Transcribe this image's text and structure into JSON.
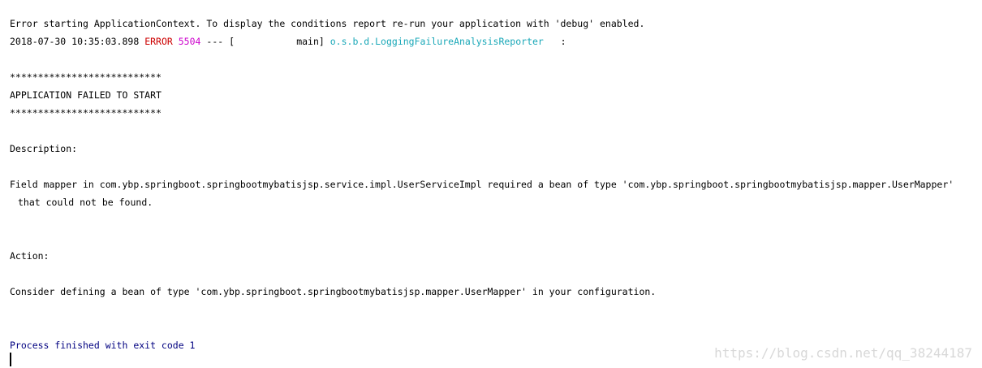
{
  "console": {
    "line1": "Error starting ApplicationContext. To display the conditions report re-run your application with 'debug' enabled.",
    "log": {
      "timestamp": "2018-07-30 10:35:03.898",
      "level": "ERROR",
      "pid": "5504",
      "separator": "---",
      "thread": "[           main]",
      "logger": "o.s.b.d.LoggingFailureAnalysisReporter",
      "colon": ":"
    },
    "stars_top": "***************************",
    "failed_title": "APPLICATION FAILED TO START",
    "stars_bottom": "***************************",
    "description_label": "Description:",
    "description_line1": "Field mapper in com.ybp.springboot.springbootmybatisjsp.service.impl.UserServiceImpl required a bean of type 'com.ybp.springboot.springbootmybatisjsp.mapper.UserMapper'",
    "description_line2": "that could not be found.",
    "action_label": "Action:",
    "action_text": "Consider defining a bean of type 'com.ybp.springboot.springbootmybatisjsp.mapper.UserMapper' in your configuration.",
    "exit_message": "Process finished with exit code 1"
  },
  "watermark": "https://blog.csdn.net/qq_38244187",
  "colors": {
    "error": "#cc0000",
    "pid": "#cc00cc",
    "logger": "#1aa8b8",
    "exit": "#000080"
  }
}
